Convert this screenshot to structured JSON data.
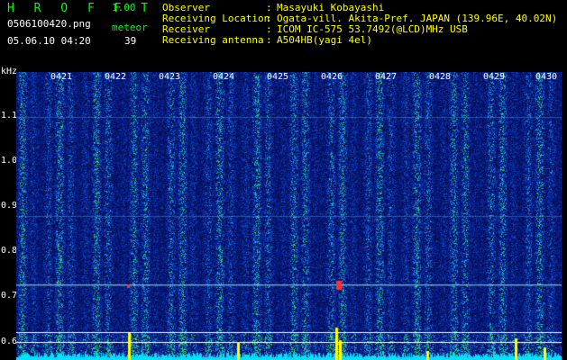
{
  "header": {
    "app_name": "H R O F F T",
    "version": "1.00",
    "filename": "0506100420.png",
    "datetime": "05.06.10 04:20",
    "event_label": "meteor",
    "event_count": "39"
  },
  "info": {
    "rows": [
      {
        "label": "Observer",
        "value": "Masayuki Kobayashi"
      },
      {
        "label": "Receiving Location",
        "value": "Ogata-vill. Akita-Pref. JAPAN (139.96E, 40.02N)"
      },
      {
        "label": "Receiver",
        "value": "ICOM IC-575 53.7492(@LCD)MHz USB"
      },
      {
        "label": "Receiving antenna",
        "value": "A504HB(yagi 4el)"
      }
    ]
  },
  "y_axis": {
    "unit": "kHz",
    "ticks": [
      "1.1",
      "1.0",
      "0.9",
      "0.8",
      "0.7",
      "0.6"
    ]
  },
  "x_axis": {
    "time_ticks": [
      "0421",
      "0422",
      "0423",
      "0424",
      "0425",
      "0426",
      "0427",
      "0428",
      "0429",
      "0430"
    ]
  },
  "colors": {
    "text_green": "#00ff00",
    "text_yellow": "#ffff00",
    "background_blue": "#0a2a9a",
    "meteor_red": "#ff3030",
    "signal_cyan": "#00e0ff"
  }
}
